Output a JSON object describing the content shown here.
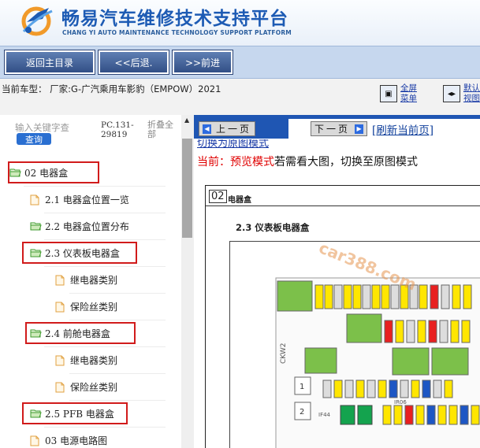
{
  "header": {
    "title": "畅易汽车维修技术支持平台",
    "subtitle": "CHANG YI AUTO MAINTENANCE TECHNOLOGY SUPPORT PLATFORM"
  },
  "toolbar": {
    "home": "返回主目录",
    "back": "<<后退.",
    "forward": ">>前进"
  },
  "infobar": {
    "car_model": "当前车型： 厂家:G-广汽乘用车影豹（EMPOW）2021",
    "fullscreen_label": "全屏\n菜单",
    "default_view_label": "默认\n视图"
  },
  "search": {
    "placeholder": "输入关键字查",
    "query_button": "查询",
    "code": "PC.131-\n29819",
    "collapse_all": "折叠全\n部"
  },
  "tree": [
    {
      "label": "02 电器盒",
      "icon": "folder-open-icon"
    },
    {
      "label": "2.1 电器盒位置一览",
      "icon": "file-icon"
    },
    {
      "label": "2.2 电器盒位置分布",
      "icon": "folder-open-icon"
    },
    {
      "label": "2.3 仪表板电器盒",
      "icon": "folder-open-icon"
    },
    {
      "label": "继电器类别",
      "icon": "file-icon"
    },
    {
      "label": "保险丝类别",
      "icon": "file-icon"
    },
    {
      "label": "2.4 前舱电器盒",
      "icon": "folder-open-icon"
    },
    {
      "label": "继电器类别",
      "icon": "file-icon"
    },
    {
      "label": "保险丝类别",
      "icon": "file-icon"
    },
    {
      "label": "2.5 PFB 电器盒",
      "icon": "folder-open-icon"
    },
    {
      "label": "03 电源电路图",
      "icon": "file-icon"
    }
  ],
  "viewer": {
    "prev_page": "上一页",
    "next_page": "下一页",
    "refresh": "[刷新当前页]",
    "switch_link": "切换为原图模式",
    "mode_prefix": "当前：",
    "mode_name": "预览模式",
    "mode_suffix": "若需看大图，切换至原图模式"
  },
  "document": {
    "section_number": "02",
    "section_title": "电器盒",
    "subsection": "2.3 仪表板电器盒",
    "watermark": "car388.com",
    "fuse_labels": [
      "CKW2",
      "1",
      "2",
      "IF44",
      "IR06"
    ]
  },
  "colors": {
    "brand_blue": "#1d5bb4",
    "toolbar_button": "#3e5d94",
    "nav_blue": "#1f56b3",
    "highlight_red": "#d11b1b",
    "preview_red": "#e00000"
  }
}
